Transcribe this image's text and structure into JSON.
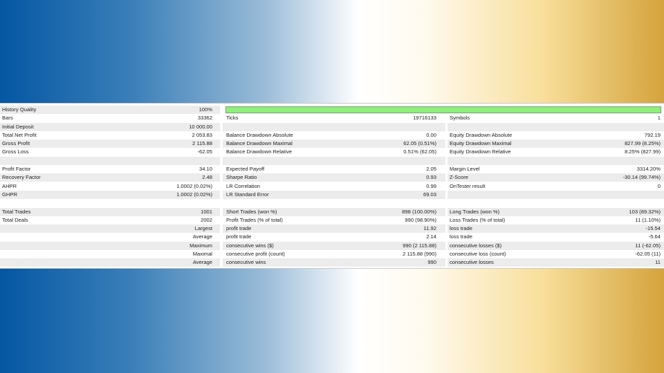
{
  "colors": {
    "row_shade": "#ececec",
    "quality_bar": "#8ef07a"
  },
  "report": {
    "history_quality": {
      "label": "History Quality",
      "value": "100%",
      "fill_percent": 100
    },
    "rows": [
      {
        "cells": [
          "Bars",
          "33362",
          "Ticks",
          "19716133",
          "Symbols",
          "1"
        ]
      },
      {
        "cells": [
          "Initial Deposit",
          "10 000.00",
          "",
          "",
          "",
          ""
        ]
      },
      {
        "cells": [
          "Total Net Profit",
          "2 053.83",
          "Balance Drawdown Absolute",
          "0.00",
          "Equity Drawdown Absolute",
          "792.19"
        ]
      },
      {
        "cells": [
          "Gross Profit",
          "2 115.88",
          "Balance Drawdown Maximal",
          "62.05 (0.51%)",
          "Equity Drawdown Maximal",
          "827.99 (8.25%)"
        ]
      },
      {
        "cells": [
          "Gross Loss",
          "-62.05",
          "Balance Drawdown Relative",
          "0.51% (62.05)",
          "Equity Drawdown Relative",
          "8.25% (827.99)"
        ]
      },
      {
        "cells": [
          "",
          "",
          "",
          "",
          "",
          ""
        ]
      },
      {
        "cells": [
          "Profit Factor",
          "34.10",
          "Expected Payoff",
          "2.05",
          "Margin Level",
          "3314.20%"
        ]
      },
      {
        "cells": [
          "Recovery Factor",
          "2.48",
          "Sharpe Ratio",
          "0.93",
          "Z-Score",
          "-30.14 (99.74%)"
        ]
      },
      {
        "cells": [
          "AHPR",
          "1.0002 (0.02%)",
          "LR Correlation",
          "0.99",
          "OnTester result",
          "0"
        ]
      },
      {
        "cells": [
          "GHPR",
          "1.0002 (0.02%)",
          "LR Standard Error",
          "69.03",
          "",
          ""
        ]
      },
      {
        "cells": [
          "",
          "",
          "",
          "",
          "",
          ""
        ]
      },
      {
        "cells": [
          "Total Trades",
          "1001",
          "Short Trades (won %)",
          "898 (100.00%)",
          "Long Trades (won %)",
          "103 (89.32%)"
        ]
      },
      {
        "cells": [
          "Total Deals",
          "2002",
          "Profit Trades (% of total)",
          "990 (98.90%)",
          "Loss Trades (% of total)",
          "11 (1.10%)"
        ]
      },
      {
        "cells": [
          "",
          "Largest",
          "profit trade",
          "11.92",
          "loss trade",
          "-15.54"
        ]
      },
      {
        "cells": [
          "",
          "Average",
          "profit trade",
          "2.14",
          "loss trade",
          "-5.64"
        ]
      },
      {
        "cells": [
          "",
          "Maximum",
          "consecutive wins ($)",
          "990 (2 115.88)",
          "consecutive losses ($)",
          "11 (-62.05)"
        ]
      },
      {
        "cells": [
          "",
          "Maximal",
          "consecutive profit (count)",
          "2 115.88 (990)",
          "consecutive loss (count)",
          "-62.05 (11)"
        ]
      },
      {
        "cells": [
          "",
          "Average",
          "consecutive wins",
          "990",
          "consecutive losses",
          "11"
        ]
      }
    ]
  }
}
